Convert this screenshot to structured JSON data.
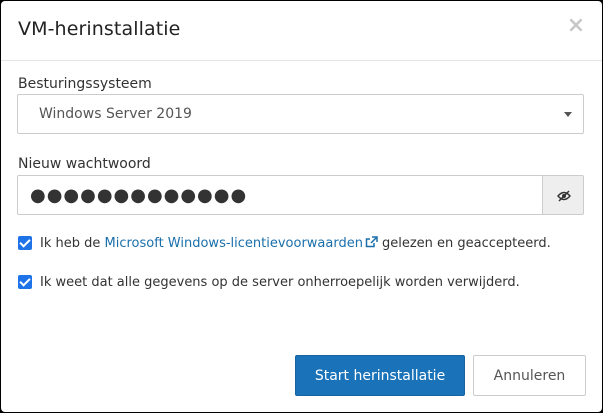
{
  "dialog": {
    "title": "VM-herinstallatie",
    "close_symbol": "×"
  },
  "os": {
    "label": "Besturingssysteem",
    "selected": "Windows Server 2019"
  },
  "password": {
    "label": "Nieuw wachtwoord",
    "value": "●●●●●●●●●●●●●",
    "toggle_icon": "eye-slash-icon"
  },
  "checks": {
    "license_prefix": "Ik heb de",
    "license_link": "Microsoft Windows-licentievoorwaarden",
    "license_suffix": "gelezen en geaccepteerd.",
    "data_loss": "Ik weet dat alle gegevens op de server onherroepelijk worden verwijderd."
  },
  "buttons": {
    "start": "Start herinstallatie",
    "cancel": "Annuleren"
  },
  "colors": {
    "primary": "#1a72b8",
    "link": "#1a6fab",
    "checkbox": "#1e73e8"
  }
}
